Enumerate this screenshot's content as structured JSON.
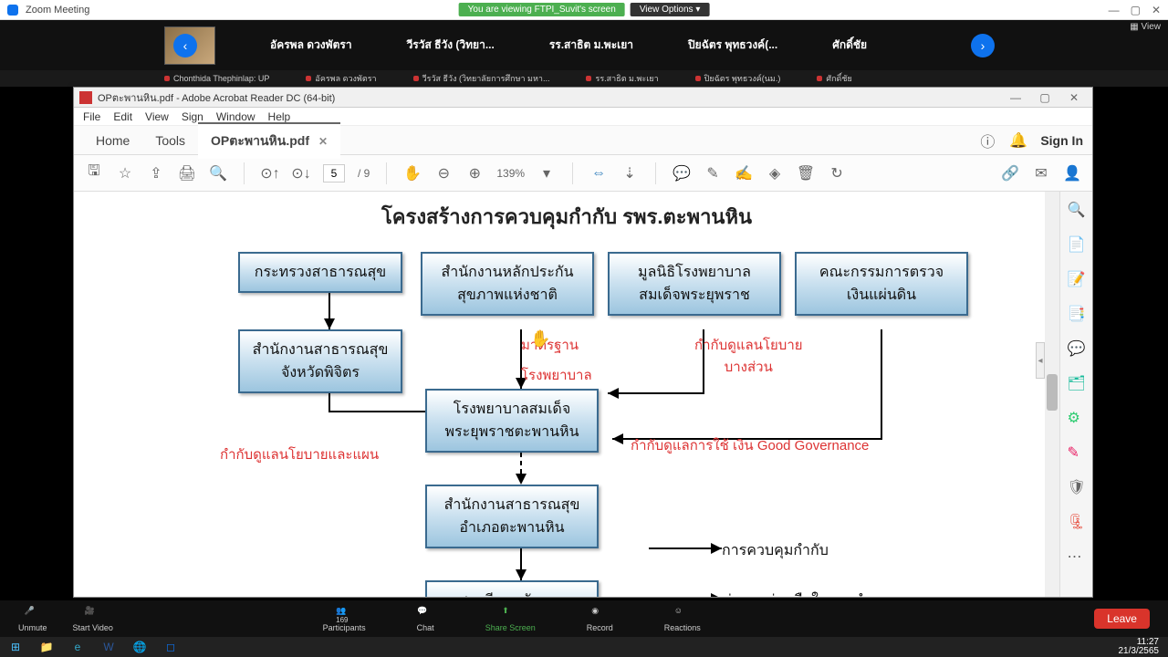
{
  "zoom": {
    "title": "Zoom Meeting",
    "share_banner": "You are viewing FTPI_Suvit's screen",
    "view_options": "View Options ▾",
    "view_label": "▦ View",
    "participants": [
      "อัครพล ดวงพัตรา",
      "วีรวัส ธีวัง (วิทยา...",
      "รร.สาธิต ม.พะเยา",
      "ปิยฉัตร พุทธวงค์(...",
      "ศักดิ์ชัย"
    ],
    "tabs": [
      "Chonthida Thephinlap: UP",
      "อัครพล ดวงพัตรา",
      "วีรวัส ธีวัง (วิทยาลัยการศึกษา มหา...",
      "รร.สาธิต ม.พะเยา",
      "ปิยฉัตร พุทธวงค์(นม.)",
      "ศักดิ์ชัย"
    ],
    "bottom": {
      "unmute": "Unmute",
      "start_video": "Start Video",
      "participants": "Participants",
      "participants_count": "169",
      "chat": "Chat",
      "share": "Share Screen",
      "record": "Record",
      "reactions": "Reactions",
      "leave": "Leave"
    }
  },
  "acrobat": {
    "window_title": "OPตะพานหิน.pdf - Adobe Acrobat Reader DC (64-bit)",
    "menu": {
      "file": "File",
      "edit": "Edit",
      "view": "View",
      "sign": "Sign",
      "window": "Window",
      "help": "Help"
    },
    "tabs": {
      "home": "Home",
      "tools": "Tools",
      "doc": "OPตะพานหิน.pdf"
    },
    "signin": "Sign In",
    "page_current": "5",
    "page_total": "/ 9",
    "zoom_level": "139%"
  },
  "doc": {
    "title": "โครงสร้างการควบคุมกำกับ  รพร.ตะพานหิน",
    "box1": "กระทรวงสาธารณสุข",
    "box2": "สำนักงานหลักประกัน\nสุขภาพแห่งชาติ",
    "box3": "มูลนิธิโรงพยาบาล\nสมเด็จพระยุพราช",
    "box4": "คณะกรรมการตรวจ\nเงินแผ่นดิน",
    "box5": "สำนักงานสาธารณสุข\nจังหวัดพิจิตร",
    "box6": "โรงพยาบาลสมเด็จ\nพระยุพราชตะพานหิน",
    "box7": "สำนักงานสาธารณสุข\nอำเภอตะพานหิน",
    "box8": "สถานีอนามัยและ\nหน่วยบริการปฐมภูมิ",
    "label_std": "มาตรฐาน",
    "label_hosp": "โรงพยาบาล",
    "label_policy_plan": "กำกับดูแลนโยบายและแผน",
    "label_policy_some": "กำกับดูแลนโยบาย\nบางส่วน",
    "label_gov": "กำกับดูแลการใช้ เงิน  Good  Governance",
    "legend_control": "การควบคุมกำกับ",
    "legend_coop": "คู่ความร่วมมือในการทำงาน"
  },
  "tray": {
    "time": "11:27",
    "date": "21/3/2565"
  }
}
